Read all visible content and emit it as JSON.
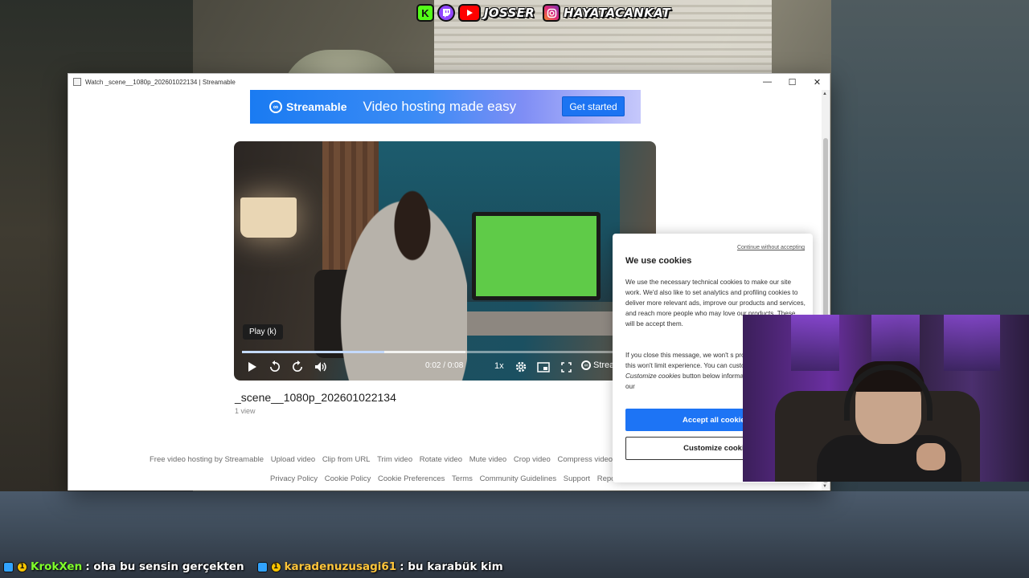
{
  "overlay": {
    "social": {
      "kick_icon": "kick-icon",
      "twitch_icon": "twitch-icon",
      "youtube_icon": "youtube-icon",
      "youtube_handle": "JOSSER",
      "instagram_icon": "instagram-icon",
      "instagram_handle": "HAYATACANKAT"
    },
    "chat": [
      {
        "user": "KrokXen",
        "message": ": oha bu sensin gerçekten",
        "badge_count": "1"
      },
      {
        "user": "karadenuzusagi61",
        "message": ": bu karabük kim",
        "badge_count": "1"
      }
    ]
  },
  "browser": {
    "tab_title": "Watch _scene__1080p_202601022134 | Streamable",
    "controls": {
      "minimize": "—",
      "maximize": "☐",
      "close": "✕"
    }
  },
  "banner": {
    "brand": "Streamable",
    "tagline": "Video hosting made easy",
    "cta": "Get started"
  },
  "player": {
    "tooltip": "Play (k)",
    "time": "0:02 / 0:08",
    "speed": "1x",
    "brand": "Strea",
    "progress_fraction": 0.35,
    "buffer_fraction": 0.55
  },
  "video": {
    "title": "_scene__1080p_202601022134",
    "views": "1 view"
  },
  "footer": {
    "row1": [
      "Free video hosting by Streamable",
      "Upload video",
      "Clip from URL",
      "Trim video",
      "Rotate video",
      "Mute video",
      "Crop video",
      "Compress video"
    ],
    "row2": [
      "Privacy Policy",
      "Cookie Policy",
      "Cookie Preferences",
      "Terms",
      "Community Guidelines",
      "Support",
      "Repo"
    ]
  },
  "cookie": {
    "continue": "Continue without accepting",
    "title": "We use cookies",
    "p1": "We use the necessary technical cookies to make our site work. We'd also like to set analytics and profiling cookies to deliver more relevant ads, improve our products and services, and reach more people who may love our products. These will be",
    "p1_end": "accept them.",
    "p2": "If you close this message, we won't s profiling cookies, and this won't limit experience. You can customize your",
    "p2_b": "the",
    "p2_italic": "Customize cookies",
    "p2_c": "button below",
    "p2_d": "information, have a look at our",
    "accept": "Accept all cookies",
    "customize": "Customize cookie"
  },
  "colors": {
    "accent": "#1d74f5",
    "progress": "#3b82f6",
    "chat_user1": "#7fff2a",
    "chat_user2": "#ffc53a"
  }
}
